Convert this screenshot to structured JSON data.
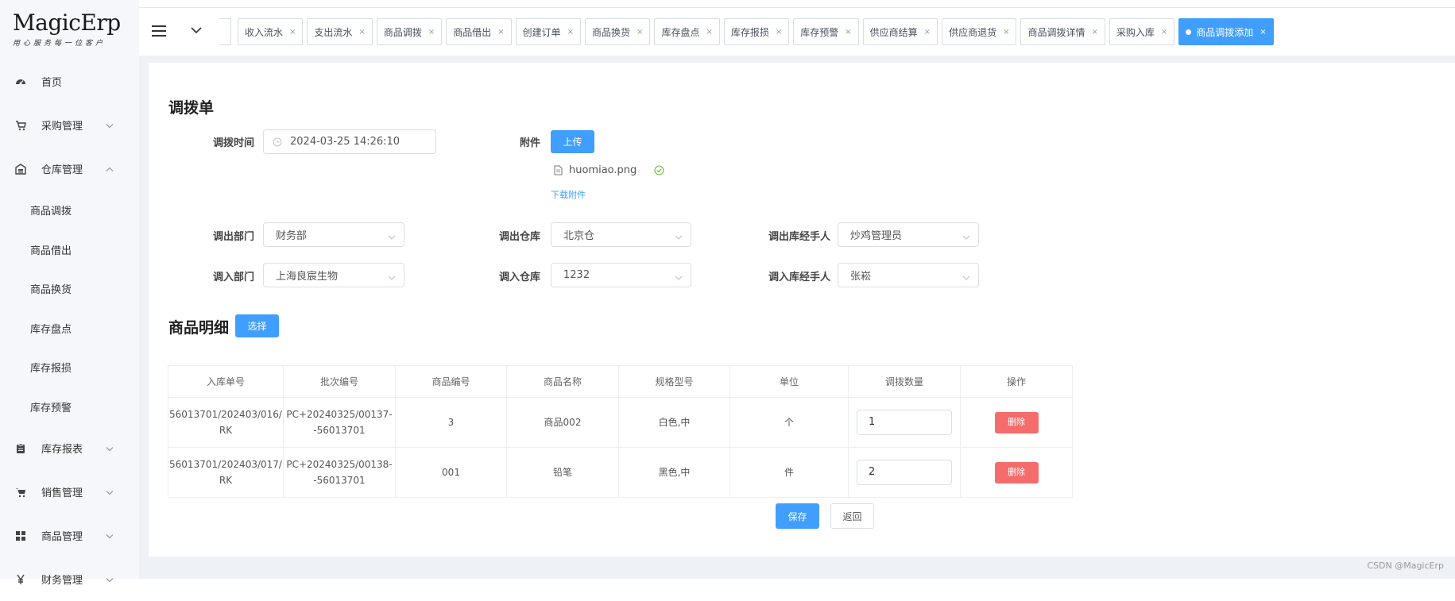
{
  "logo": {
    "brand": "MagicErp",
    "slogan": "用心服务每一位客户"
  },
  "sidebar": {
    "items": [
      {
        "label": "首页",
        "icon": "dashboard-icon",
        "expandable": false
      },
      {
        "label": "采购管理",
        "icon": "cart-icon",
        "expandable": true,
        "expanded": false
      },
      {
        "label": "仓库管理",
        "icon": "warehouse-icon",
        "expandable": true,
        "expanded": true,
        "children": [
          {
            "label": "商品调拨"
          },
          {
            "label": "商品借出"
          },
          {
            "label": "商品换货"
          },
          {
            "label": "库存盘点"
          },
          {
            "label": "库存报损"
          },
          {
            "label": "库存预警"
          }
        ]
      },
      {
        "label": "库存报表",
        "icon": "clipboard-icon",
        "expandable": true,
        "expanded": false
      },
      {
        "label": "销售管理",
        "icon": "cart-icon",
        "expandable": true,
        "expanded": false
      },
      {
        "label": "商品管理",
        "icon": "grid-icon",
        "expandable": true,
        "expanded": false
      },
      {
        "label": "财务管理",
        "icon": "yen-icon",
        "expandable": true,
        "expanded": false
      }
    ]
  },
  "tabs": [
    {
      "label": "收入流水"
    },
    {
      "label": "支出流水"
    },
    {
      "label": "商品调拨"
    },
    {
      "label": "商品借出"
    },
    {
      "label": "创建订单"
    },
    {
      "label": "商品换货"
    },
    {
      "label": "库存盘点"
    },
    {
      "label": "库存报损"
    },
    {
      "label": "库存预警"
    },
    {
      "label": "供应商结算"
    },
    {
      "label": "供应商退货"
    },
    {
      "label": "商品调拨详情"
    },
    {
      "label": "采购入库"
    },
    {
      "label": "商品调拨添加",
      "active": true
    }
  ],
  "form": {
    "title": "调拨单",
    "time_label": "调拨时间",
    "time_value": "2024-03-25 14:26:10",
    "attach_label": "附件",
    "upload_label": "上传",
    "file_name": "huomiao.png",
    "download_label": "下载附件",
    "out_dept_label": "调出部门",
    "out_dept_value": "财务部",
    "out_wh_label": "调出仓库",
    "out_wh_value": "北京仓",
    "out_handler_label": "调出库经手人",
    "out_handler_value": "炒鸡管理员",
    "in_dept_label": "调入部门",
    "in_dept_value": "上海良宸生物",
    "in_wh_label": "调入仓库",
    "in_wh_value": "1232",
    "in_handler_label": "调入库经手人",
    "in_handler_value": "张崧"
  },
  "detail": {
    "title": "商品明细",
    "select_label": "选择",
    "columns": [
      "入库单号",
      "批次编号",
      "商品编号",
      "商品名称",
      "规格型号",
      "单位",
      "调拨数量",
      "操作"
    ],
    "rows": [
      {
        "inbound_line1": "56013701/202403/016/",
        "inbound_line2": "RK",
        "batch_line1": "PC+20240325/00137-",
        "batch_line2": "-56013701",
        "code": "3",
        "name": "商品002",
        "spec": "白色,中",
        "unit": "个",
        "qty": "1",
        "action": "删除"
      },
      {
        "inbound_line1": "56013701/202403/017/",
        "inbound_line2": "RK",
        "batch_line1": "PC+20240325/00138-",
        "batch_line2": "-56013701",
        "code": "001",
        "name": "铅笔",
        "spec": "黑色,中",
        "unit": "件",
        "qty": "2",
        "action": "删除"
      }
    ]
  },
  "actions": {
    "save_label": "保存",
    "back_label": "返回"
  },
  "watermark": "CSDN @MagicErp",
  "colors": {
    "primary": "#409eff",
    "danger": "#f56c6c",
    "content_bg": "#eef1f5",
    "sidebar_bg": "#f5f7fa"
  }
}
